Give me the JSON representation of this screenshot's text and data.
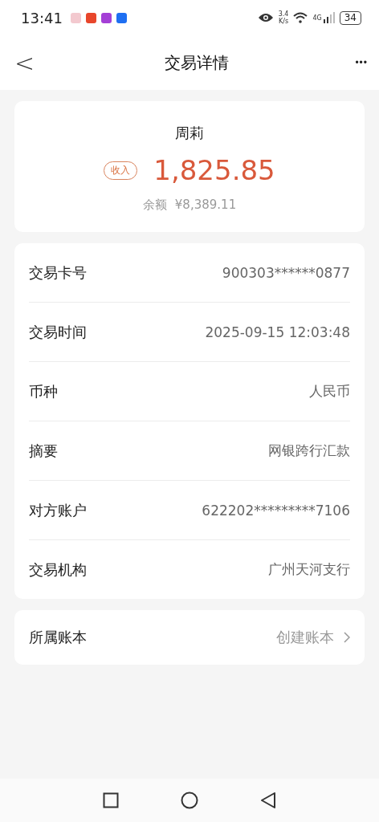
{
  "status_bar": {
    "time": "13:41",
    "speed_value": "3.4",
    "speed_unit": "K/s",
    "network": "4G",
    "battery": "34"
  },
  "header": {
    "back": "<",
    "title": "交易详情",
    "more": "•••"
  },
  "summary": {
    "payee": "周莉",
    "direction": "收入",
    "amount": "1,825.85",
    "balance_label": "余额",
    "balance": "¥8,389.11"
  },
  "details": [
    {
      "label": "交易卡号",
      "value": "900303******0877"
    },
    {
      "label": "交易时间",
      "value": "2025-09-15 12:03:48"
    },
    {
      "label": "币种",
      "value": "人民币"
    },
    {
      "label": "摘要",
      "value": "网银跨行汇款"
    },
    {
      "label": "对方账户",
      "value": "622202*********7106"
    },
    {
      "label": "交易机构",
      "value": "广州天河支行"
    }
  ],
  "ledger": {
    "label": "所属账本",
    "action": "创建账本"
  }
}
